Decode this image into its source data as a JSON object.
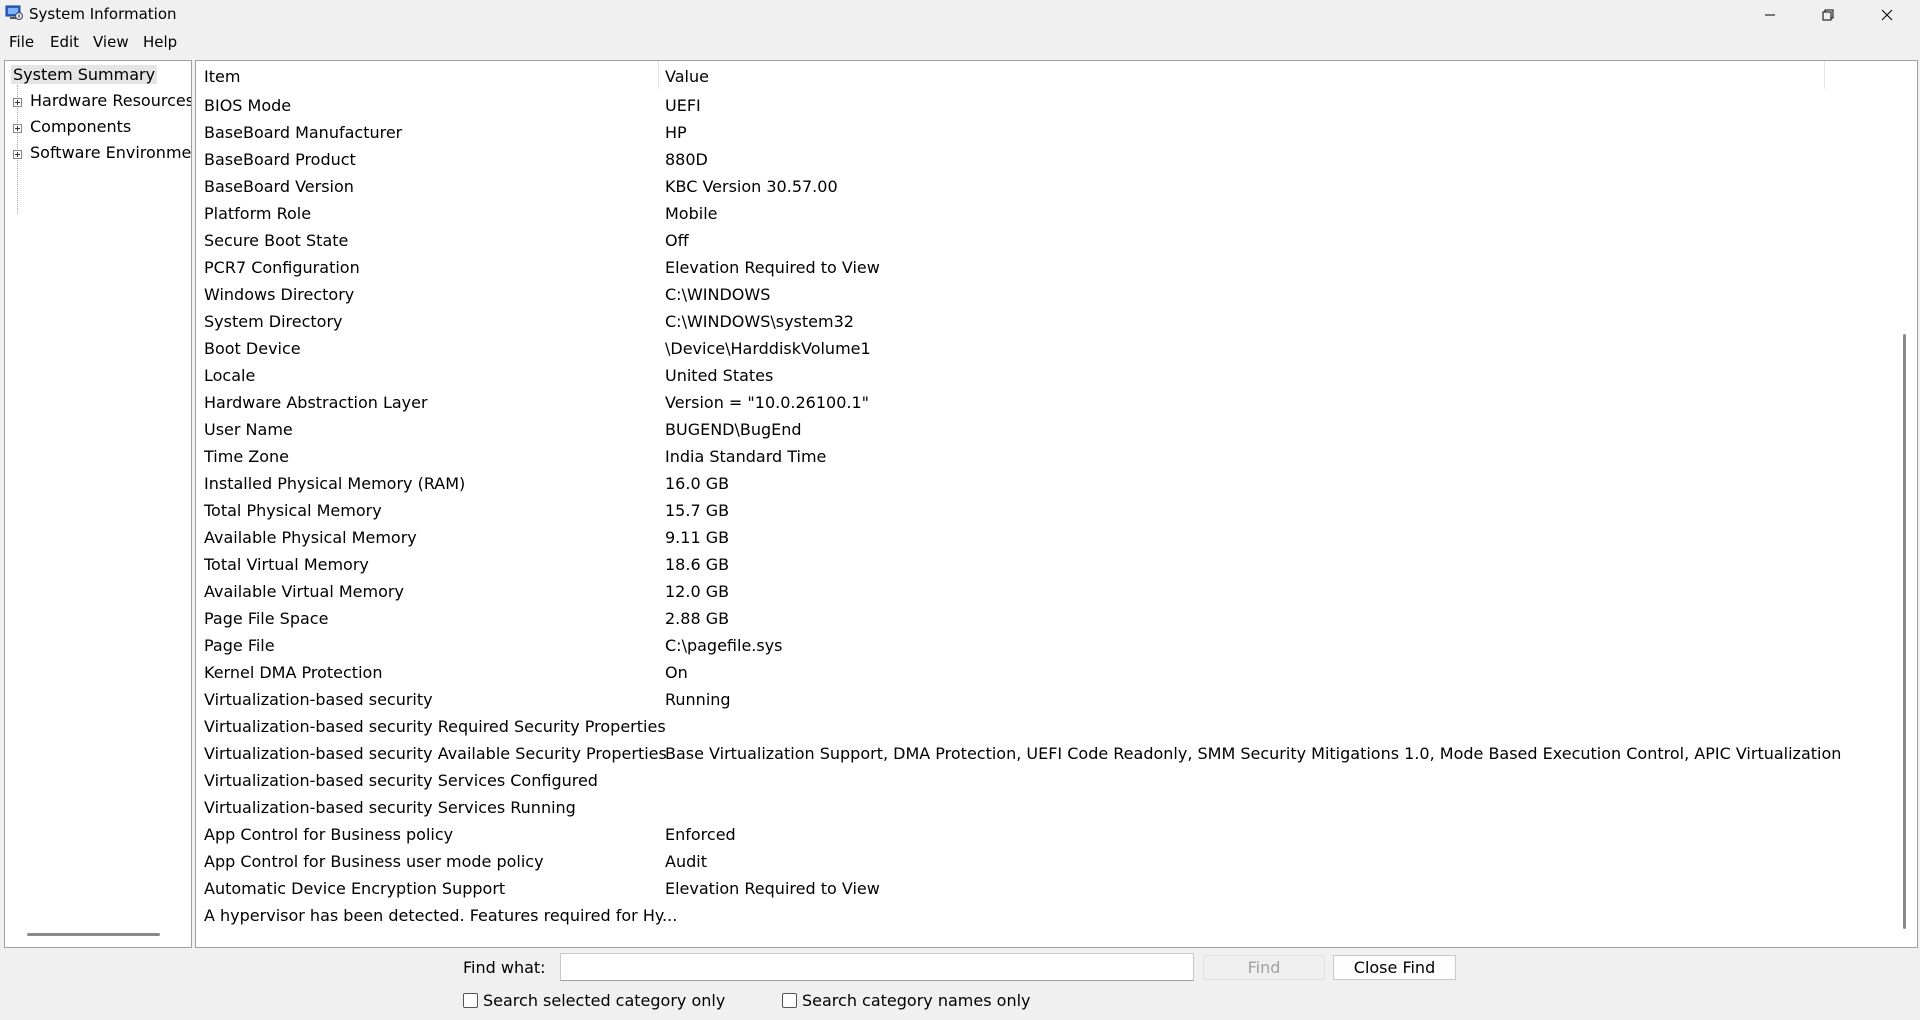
{
  "window": {
    "title": "System Information",
    "icon": "system-information-app-icon",
    "controls": [
      "minimize-icon",
      "restore-icon",
      "close-icon"
    ]
  },
  "menu": {
    "file": "File",
    "edit": "Edit",
    "view": "View",
    "help": "Help"
  },
  "tree": {
    "root": "System Summary",
    "children": [
      "Hardware Resources",
      "Components",
      "Software Environment"
    ]
  },
  "list": {
    "header_item": "Item",
    "header_value": "Value",
    "rows": [
      {
        "item": "BIOS Mode",
        "value": "UEFI"
      },
      {
        "item": "BaseBoard Manufacturer",
        "value": "HP"
      },
      {
        "item": "BaseBoard Product",
        "value": "880D"
      },
      {
        "item": "BaseBoard Version",
        "value": "KBC Version 30.57.00"
      },
      {
        "item": "Platform Role",
        "value": "Mobile"
      },
      {
        "item": "Secure Boot State",
        "value": "Off"
      },
      {
        "item": "PCR7 Configuration",
        "value": "Elevation Required to View"
      },
      {
        "item": "Windows Directory",
        "value": "C:\\WINDOWS"
      },
      {
        "item": "System Directory",
        "value": "C:\\WINDOWS\\system32"
      },
      {
        "item": "Boot Device",
        "value": "\\Device\\HarddiskVolume1"
      },
      {
        "item": "Locale",
        "value": "United States"
      },
      {
        "item": "Hardware Abstraction Layer",
        "value": "Version = \"10.0.26100.1\""
      },
      {
        "item": "User Name",
        "value": "BUGEND\\BugEnd"
      },
      {
        "item": "Time Zone",
        "value": "India Standard Time"
      },
      {
        "item": "Installed Physical Memory (RAM)",
        "value": "16.0 GB"
      },
      {
        "item": "Total Physical Memory",
        "value": "15.7 GB"
      },
      {
        "item": "Available Physical Memory",
        "value": "9.11 GB"
      },
      {
        "item": "Total Virtual Memory",
        "value": "18.6 GB"
      },
      {
        "item": "Available Virtual Memory",
        "value": "12.0 GB"
      },
      {
        "item": "Page File Space",
        "value": "2.88 GB"
      },
      {
        "item": "Page File",
        "value": "C:\\pagefile.sys"
      },
      {
        "item": "Kernel DMA Protection",
        "value": "On"
      },
      {
        "item": "Virtualization-based security",
        "value": "Running"
      },
      {
        "item": "Virtualization-based security Required Security Properties",
        "value": ""
      },
      {
        "item": "Virtualization-based security Available Security Properties",
        "value": "Base Virtualization Support, DMA Protection, UEFI Code Readonly, SMM Security Mitigations 1.0, Mode Based Execution Control, APIC Virtualization"
      },
      {
        "item": "Virtualization-based security Services Configured",
        "value": ""
      },
      {
        "item": "Virtualization-based security Services Running",
        "value": ""
      },
      {
        "item": "App Control for Business policy",
        "value": "Enforced"
      },
      {
        "item": "App Control for Business user mode policy",
        "value": "Audit"
      },
      {
        "item": "Automatic Device Encryption Support",
        "value": "Elevation Required to View"
      },
      {
        "item": "A hypervisor has been detected. Features required for Hy...",
        "value": ""
      }
    ]
  },
  "find": {
    "label": "Find what:",
    "value": "",
    "find_button": "Find",
    "close_button": "Close Find",
    "search_selected": "Search selected category only",
    "search_names": "Search category names only"
  }
}
